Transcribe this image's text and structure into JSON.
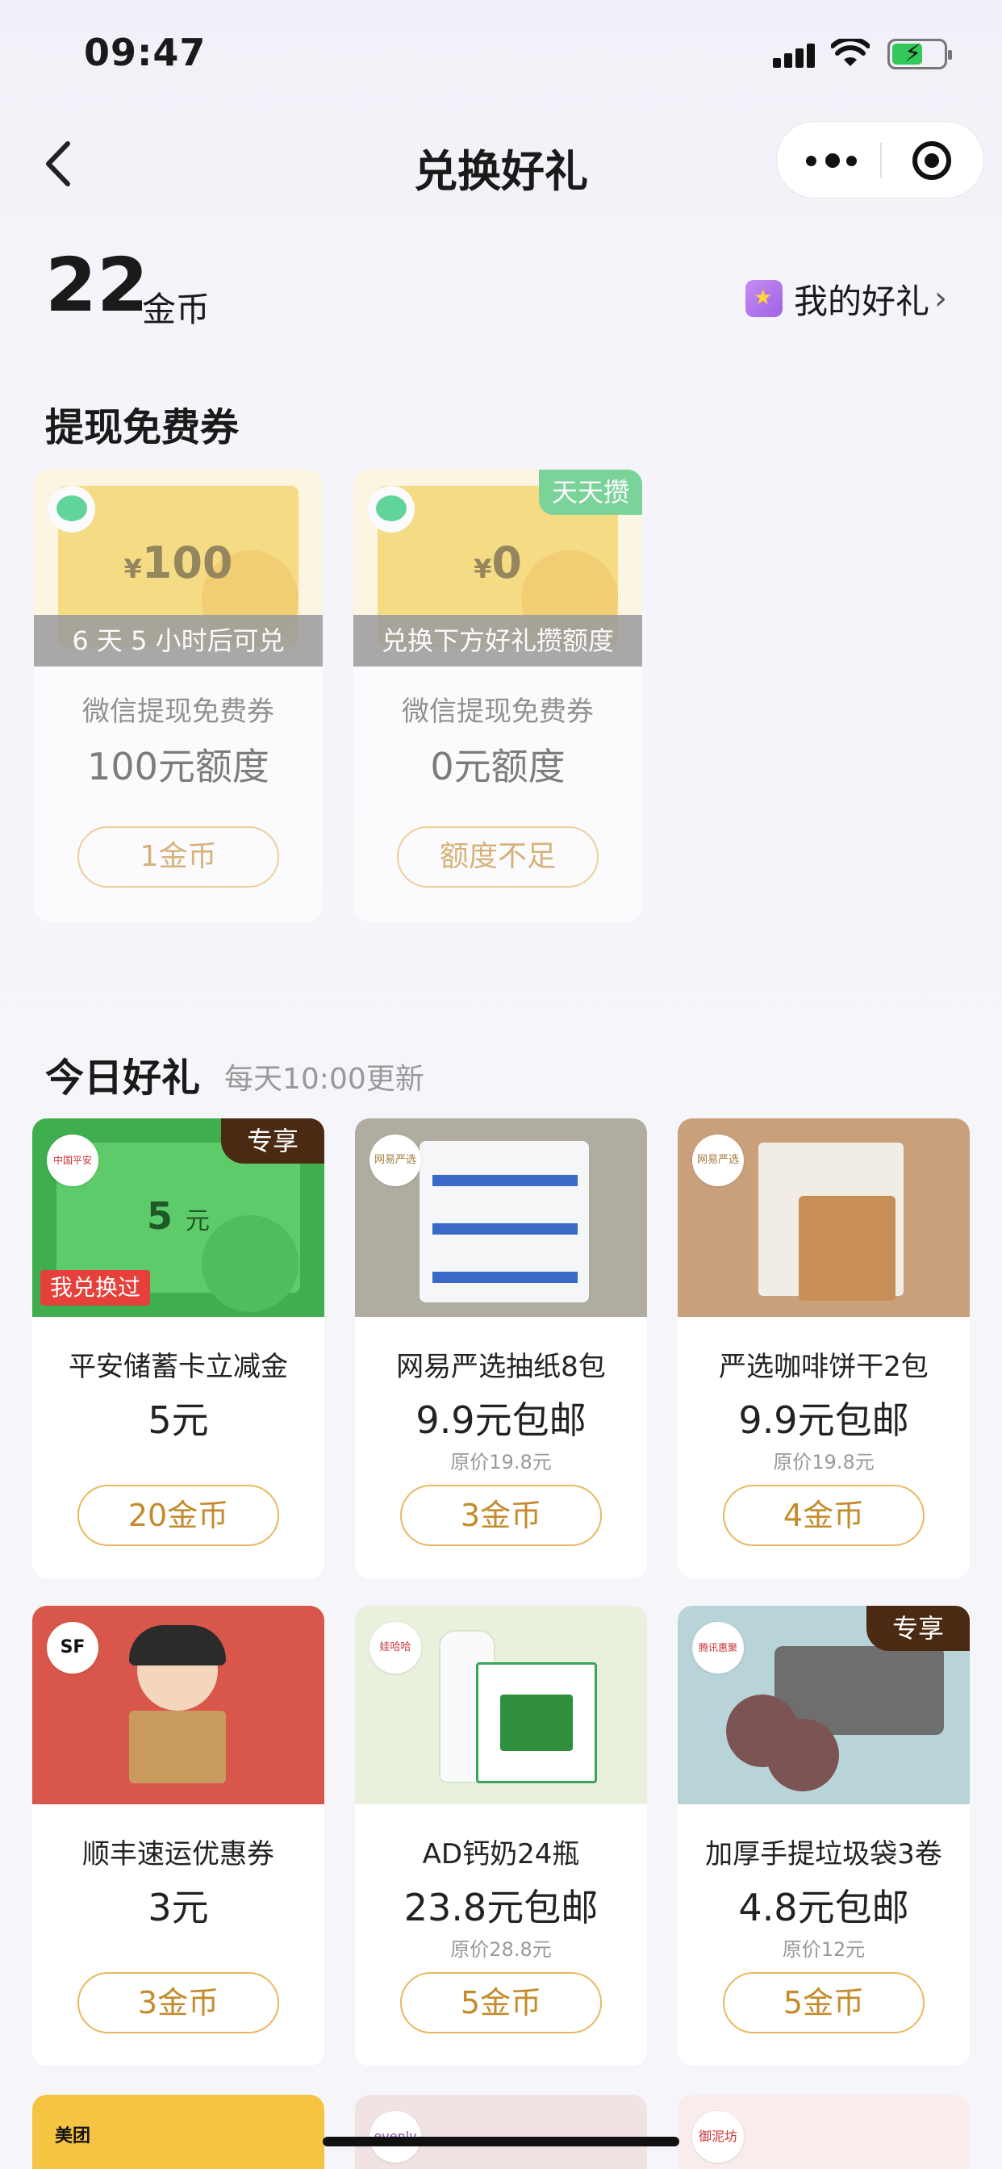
{
  "status_bar": {
    "time": "09:47"
  },
  "nav": {
    "title": "兑换好礼"
  },
  "balance": {
    "amount": "22",
    "unit": "金币"
  },
  "my_gifts": {
    "label": "我的好礼",
    "chevron": "›"
  },
  "withdraw_section": {
    "title": "提现免费券",
    "cards": [
      {
        "currency": "¥",
        "amount": "100",
        "strip": "6 天 5 小时后可兑",
        "name": "微信提现免费券",
        "quota": "100元额度",
        "button": "1金币",
        "tag": ""
      },
      {
        "currency": "¥",
        "amount": "0",
        "strip": "兑换下方好礼攒额度",
        "name": "微信提现免费券",
        "quota": "0元额度",
        "button": "额度不足",
        "tag": "天天攒"
      }
    ]
  },
  "today_section": {
    "title": "今日好礼",
    "subtitle": "每天10:00更新",
    "products": [
      {
        "name": "平安储蓄卡立减金",
        "price": "5元",
        "original": "",
        "button": "20金币",
        "badge": "专享",
        "logo": "中国平安",
        "image_value": "5",
        "image_unit": "元",
        "exchanged": "我兑换过"
      },
      {
        "name": "网易严选抽纸8包",
        "price": "9.9元包邮",
        "original": "原价19.8元",
        "button": "3金币",
        "badge": "",
        "logo": "网易严选"
      },
      {
        "name": "严选咖啡饼干2包",
        "price": "9.9元包邮",
        "original": "原价19.8元",
        "button": "4金币",
        "badge": "",
        "logo": "网易严选"
      },
      {
        "name": "顺丰速运优惠券",
        "price": "3元",
        "original": "",
        "button": "3金币",
        "badge": "",
        "logo": "SF"
      },
      {
        "name": "AD钙奶24瓶",
        "price": "23.8元包邮",
        "original": "原价28.8元",
        "button": "5金币",
        "badge": "",
        "logo": "娃哈哈"
      },
      {
        "name": "加厚手提垃圾袋3卷",
        "price": "4.8元包邮",
        "original": "原价12元",
        "button": "5金币",
        "badge": "专享",
        "logo": "腾讯惠聚"
      }
    ],
    "partial_row": [
      {
        "logo": "美团"
      },
      {
        "logo": "evenly"
      },
      {
        "logo": "御泥坊"
      }
    ]
  }
}
